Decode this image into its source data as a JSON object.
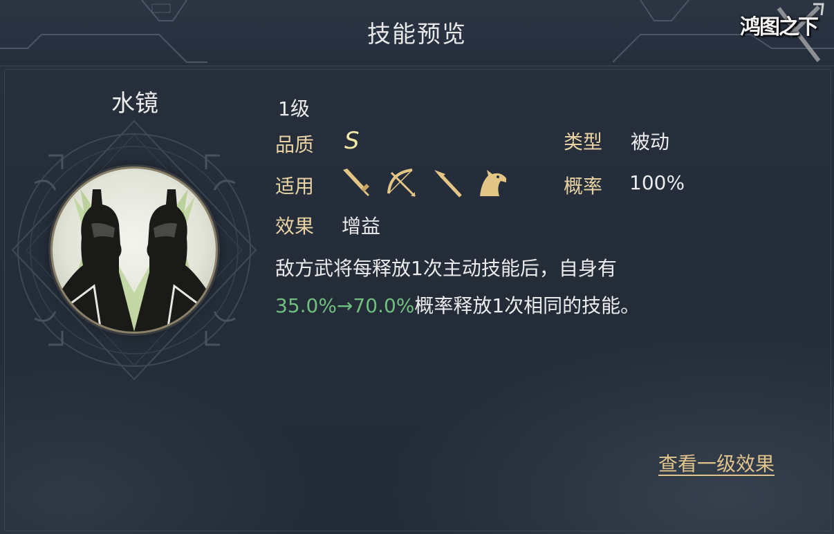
{
  "header": {
    "title": "技能预览",
    "logo_text": "鸿图之下"
  },
  "skill": {
    "name": "水镜",
    "level": "1级",
    "quality_label": "品质",
    "quality_value": "S",
    "type_label": "类型",
    "type_value": "被动",
    "apply_label": "适用",
    "troop_types": [
      "sword-icon",
      "bow-icon",
      "spear-icon",
      "horse-icon"
    ],
    "rate_label": "概率",
    "rate_value": "100%",
    "effect_label": "效果",
    "effect_value": "增益",
    "description_line1": "敌方武将每释放1次主动技能后，自身有",
    "description_highlight": "35.0%→70.0%",
    "description_line2_rest": "概率释放1次相同的技能。"
  },
  "link": {
    "view_level1": "查看一级效果"
  },
  "colors": {
    "label_gold": "#e9d3a3",
    "highlight_green": "#6fbf7e",
    "link_gold": "#e2c48a",
    "quality_yellow": "#f2e7a6"
  }
}
